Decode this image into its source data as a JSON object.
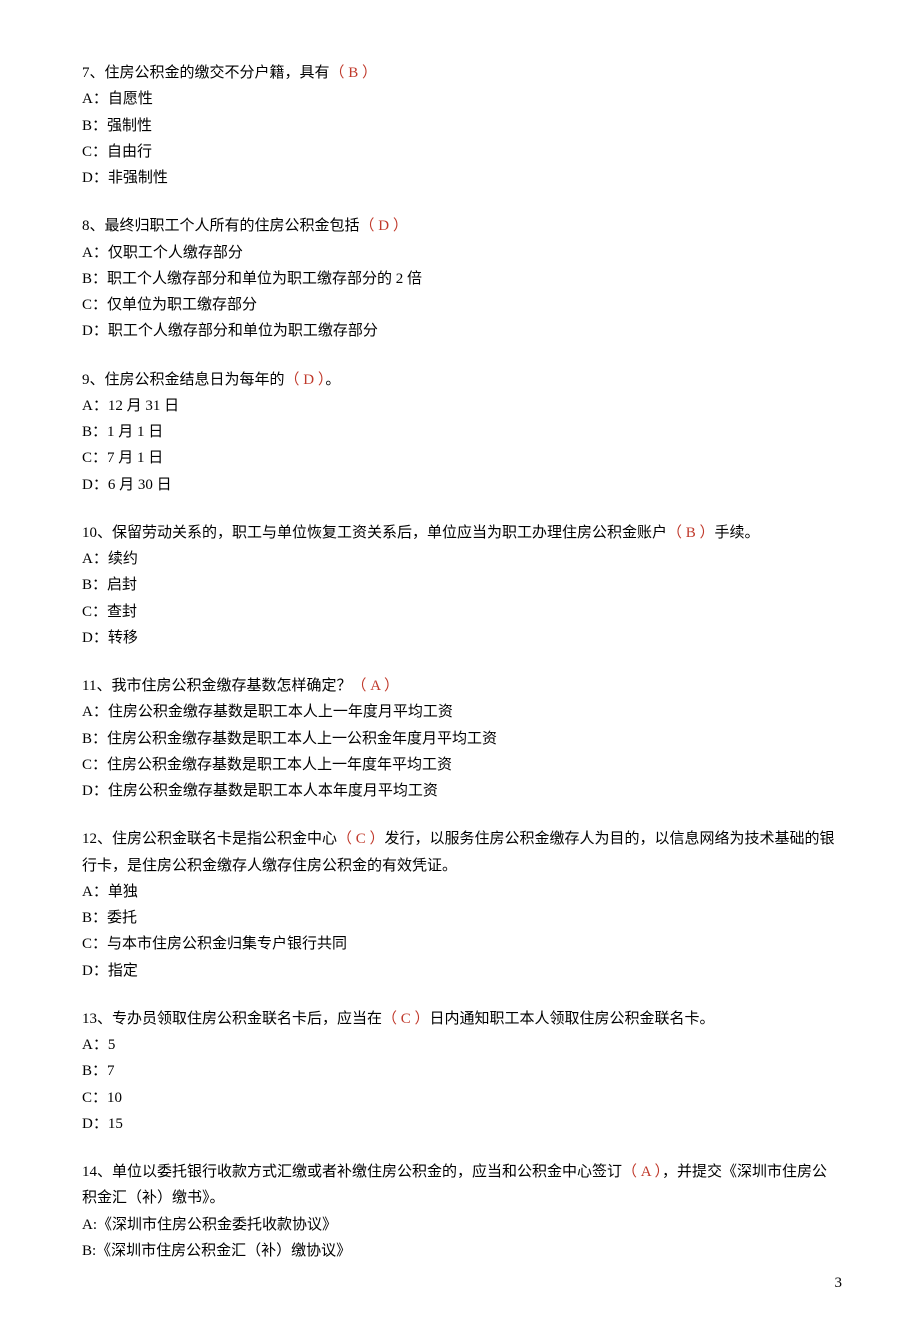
{
  "questions": [
    {
      "stem_before": "7、住房公积金的缴交不分户籍，具有",
      "answer": "（ B ）",
      "stem_after": "",
      "options": [
        "A：自愿性",
        "B：强制性",
        "C：自由行",
        "D：非强制性"
      ]
    },
    {
      "stem_before": "8、最终归职工个人所有的住房公积金包括",
      "answer": "（ D ）",
      "stem_after": "",
      "options": [
        "A：仅职工个人缴存部分",
        "B：职工个人缴存部分和单位为职工缴存部分的 2 倍",
        "C：仅单位为职工缴存部分",
        "D：职工个人缴存部分和单位为职工缴存部分"
      ]
    },
    {
      "stem_before": "9、住房公积金结息日为每年的",
      "answer": "（ D ）",
      "stem_after": "。",
      "options": [
        "A：12 月 31 日",
        "B：1 月 1 日",
        "C：7 月 1 日",
        "D：6 月 30 日"
      ]
    },
    {
      "stem_before": "10、保留劳动关系的，职工与单位恢复工资关系后，单位应当为职工办理住房公积金账户",
      "answer": "（ B ）",
      "stem_after": "手续。",
      "options": [
        "A：续约",
        "B：启封",
        "C：查封",
        "D：转移"
      ]
    },
    {
      "stem_before": "11、我市住房公积金缴存基数怎样确定？",
      "answer": "（ A ）",
      "stem_after": "",
      "options": [
        "A：住房公积金缴存基数是职工本人上一年度月平均工资",
        "B：住房公积金缴存基数是职工本人上一公积金年度月平均工资",
        "C：住房公积金缴存基数是职工本人上一年度年平均工资",
        "D：住房公积金缴存基数是职工本人本年度月平均工资"
      ]
    },
    {
      "stem_before": "12、住房公积金联名卡是指公积金中心",
      "answer": "（ C ）",
      "stem_after": "发行，以服务住房公积金缴存人为目的，以信息网络为技术基础的银行卡，是住房公积金缴存人缴存住房公积金的有效凭证。",
      "options": [
        "A：单独",
        "B：委托",
        "C：与本市住房公积金归集专户银行共同",
        "D：指定"
      ]
    },
    {
      "stem_before": "13、专办员领取住房公积金联名卡后，应当在",
      "answer": "（ C ）",
      "stem_after": "日内通知职工本人领取住房公积金联名卡。",
      "options": [
        "A：5",
        "B：7",
        "C：10",
        "D：15"
      ]
    },
    {
      "stem_before": "14、单位以委托银行收款方式汇缴或者补缴住房公积金的，应当和公积金中心签订",
      "answer": "（ A ）",
      "stem_after": "，并提交《深圳市住房公积金汇（补）缴书》。",
      "options": [
        "A:《深圳市住房公积金委托收款协议》",
        "B:《深圳市住房公积金汇（补）缴协议》"
      ]
    }
  ],
  "page_number": "3"
}
